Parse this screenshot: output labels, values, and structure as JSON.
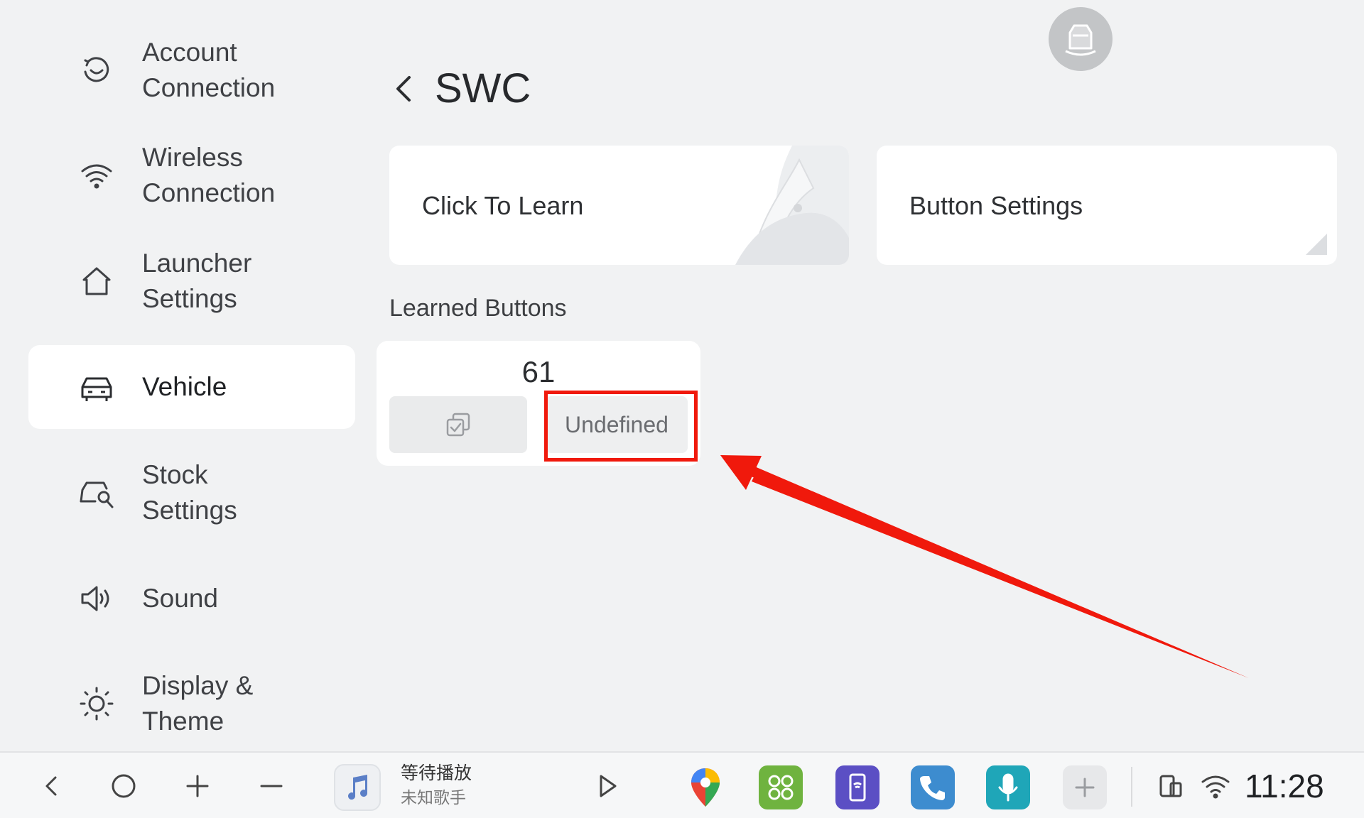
{
  "header": {
    "title": "SWC"
  },
  "sidebar": {
    "items": [
      {
        "label": "Account\nConnection",
        "icon": "account-link-icon"
      },
      {
        "label": "Wireless\nConnection",
        "icon": "wifi-icon"
      },
      {
        "label": "Launcher\nSettings",
        "icon": "home-icon"
      },
      {
        "label": "Vehicle",
        "icon": "car-icon",
        "active": true
      },
      {
        "label": "Stock\nSettings",
        "icon": "car-wrench-icon"
      },
      {
        "label": "Sound",
        "icon": "speaker-icon"
      },
      {
        "label": "Display &\nTheme",
        "icon": "brightness-icon"
      }
    ]
  },
  "cards": {
    "learn_label": "Click To Learn",
    "settings_label": "Button Settings"
  },
  "learned": {
    "section_label": "Learned Buttons",
    "items": [
      {
        "code": "61",
        "function": "Undefined"
      }
    ]
  },
  "taskbar": {
    "song_title": "等待播放",
    "song_artist": "未知歌手",
    "time": "11:28",
    "apps": [
      "maps-icon",
      "app-grid-icon",
      "phone-link-icon",
      "phone-icon",
      "voice-assistant-icon",
      "add-app-icon"
    ]
  },
  "colors": {
    "accent_highlight": "#f0190c",
    "background": "#f1f2f3",
    "card": "#ffffff"
  }
}
